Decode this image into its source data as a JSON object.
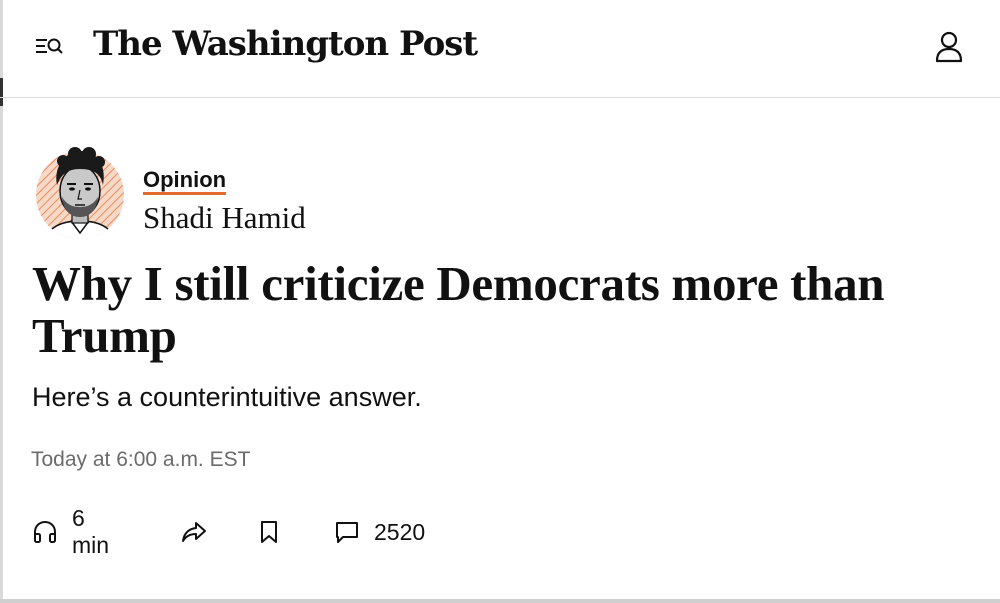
{
  "header": {
    "brand": "The Washington Post",
    "menu_icon": "menu-search-icon",
    "account_icon": "user-icon"
  },
  "byline": {
    "section": "Opinion",
    "author": "Shadi Hamid",
    "section_underline_color": "#e36b2f"
  },
  "article": {
    "headline": "Why I still criticize Democrats more than Trump",
    "dek": "Here’s a counterintuitive answer.",
    "timestamp": "Today at 6:00 a.m. EST"
  },
  "actions": {
    "listen_label": "6 min",
    "listen_icon": "headphones-icon",
    "share_icon": "share-icon",
    "save_icon": "bookmark-icon",
    "comments_icon": "comment-icon",
    "comments_count": "2520"
  }
}
